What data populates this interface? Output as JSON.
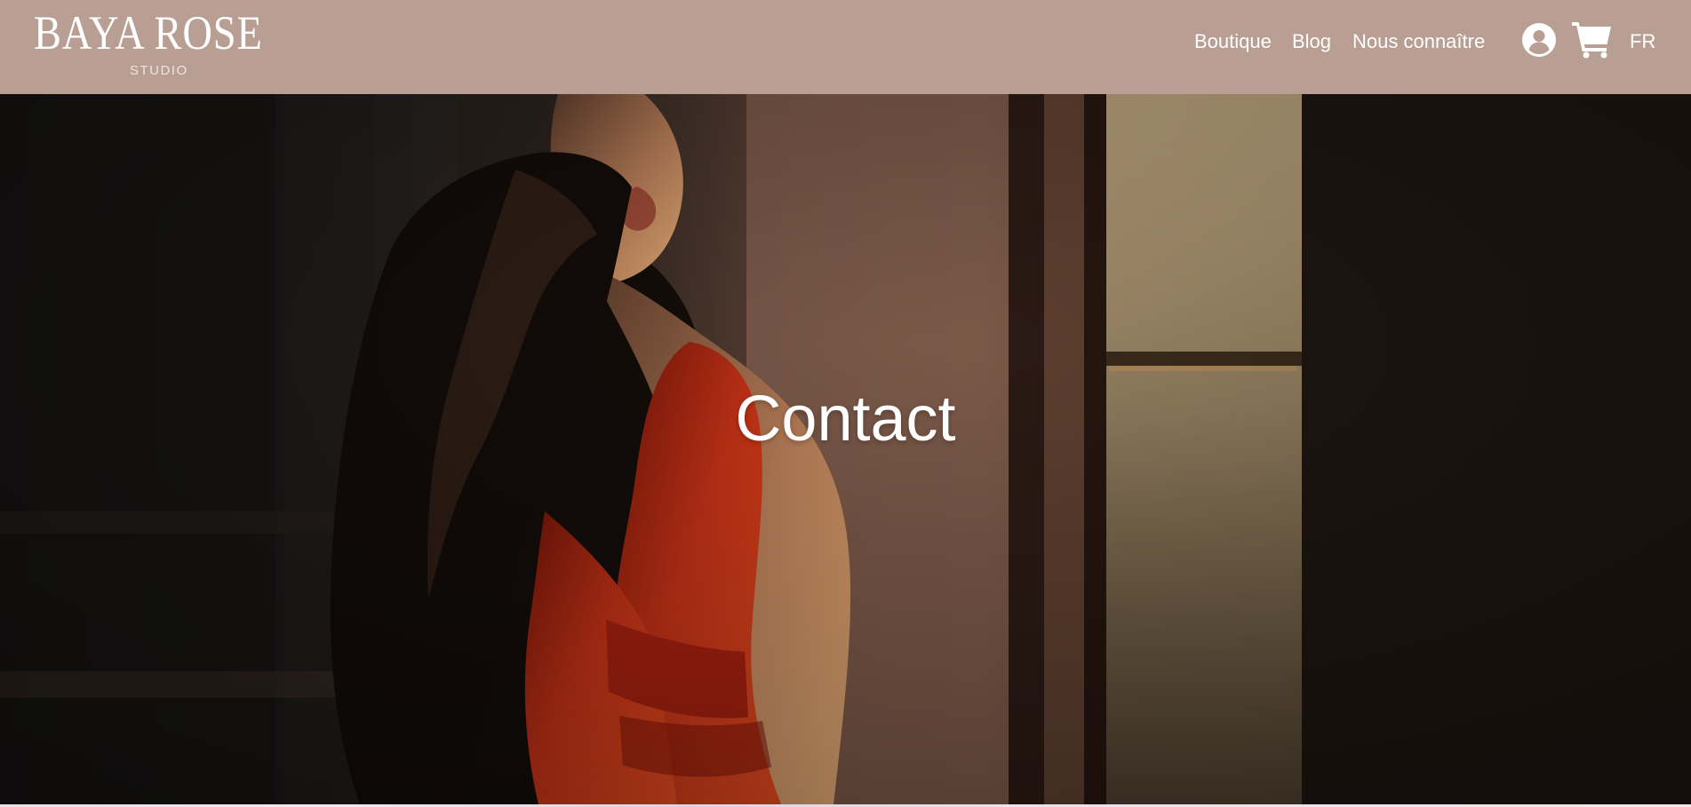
{
  "brand": {
    "name": "BAYA ROSE",
    "sub": "STUDIO"
  },
  "nav": {
    "items": [
      "Boutique",
      "Blog",
      "Nous connaître"
    ]
  },
  "header_actions": {
    "account_icon": "user-circle-icon",
    "cart_icon": "shopping-cart-icon",
    "language": "FR"
  },
  "hero": {
    "title": "Contact"
  },
  "colors": {
    "header_bg": "#b89e93",
    "text_light": "#ffffff"
  }
}
